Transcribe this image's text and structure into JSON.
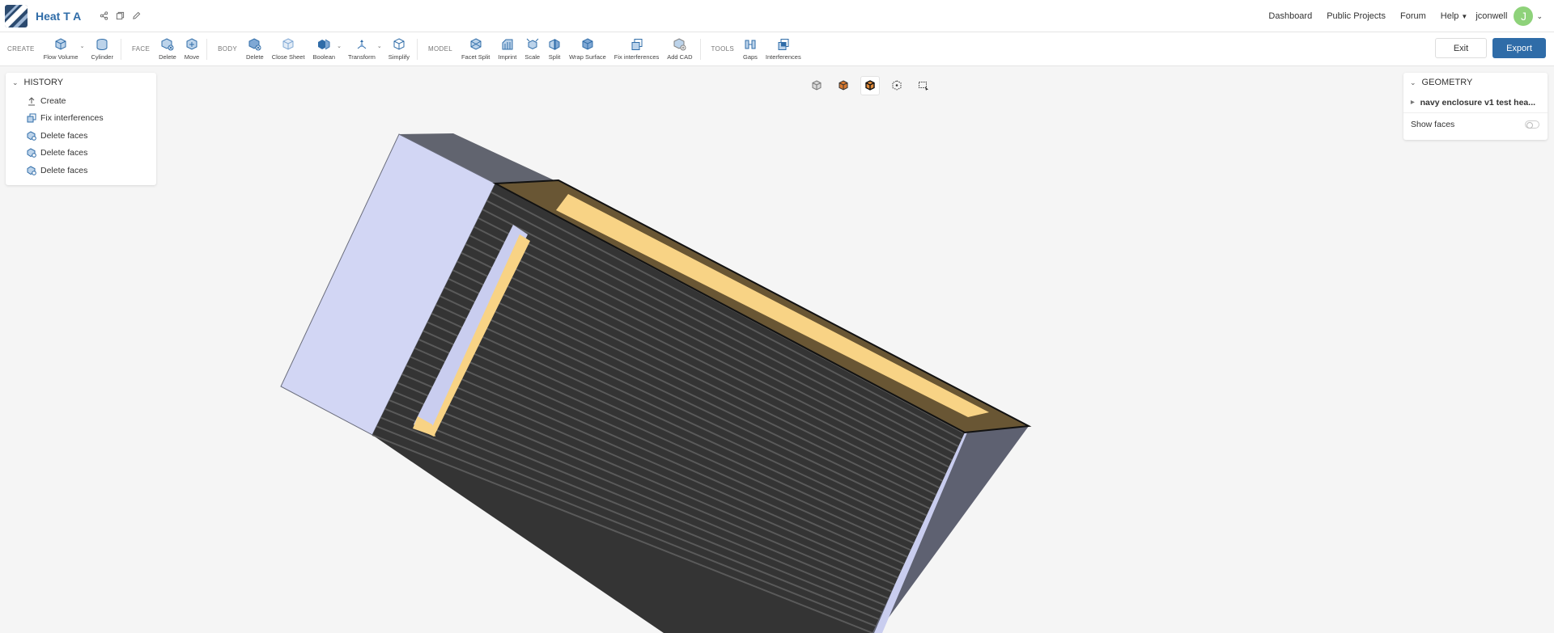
{
  "header": {
    "project_title": "Heat T A",
    "nav": {
      "dashboard": "Dashboard",
      "public_projects": "Public Projects",
      "forum": "Forum",
      "help": "Help",
      "user": "jconwell",
      "avatar_initial": "J"
    }
  },
  "toolbar": {
    "groups": {
      "create": "CREATE",
      "face": "FACE",
      "body": "BODY",
      "model": "MODEL",
      "tools": "TOOLS"
    },
    "create": {
      "flow_volume": "Flow Volume",
      "cylinder": "Cylinder"
    },
    "face": {
      "delete": "Delete",
      "move": "Move"
    },
    "body": {
      "delete": "Delete",
      "close_sheet": "Close Sheet",
      "boolean": "Boolean",
      "transform": "Transform",
      "simplify": "Simplify"
    },
    "model": {
      "facet_split": "Facet Split",
      "imprint": "Imprint",
      "scale": "Scale",
      "split": "Split",
      "wrap_surface": "Wrap Surface",
      "fix_interferences": "Fix interferences",
      "add_cad": "Add CAD"
    },
    "tools": {
      "gaps": "Gaps",
      "interferences": "Interferences"
    },
    "exit_label": "Exit",
    "export_label": "Export"
  },
  "history": {
    "title": "HISTORY",
    "items": [
      {
        "label": "Create",
        "icon": "upload-icon"
      },
      {
        "label": "Fix interferences",
        "icon": "fix-interferences-icon"
      },
      {
        "label": "Delete faces",
        "icon": "delete-faces-icon"
      },
      {
        "label": "Delete faces",
        "icon": "delete-faces-icon"
      },
      {
        "label": "Delete faces",
        "icon": "delete-faces-icon"
      }
    ]
  },
  "geometry": {
    "title": "GEOMETRY",
    "item": "navy enclosure v1 test hea...",
    "show_faces": "Show faces",
    "show_faces_on": false
  },
  "colors": {
    "accent": "#2f6ca8",
    "avatar": "#8ed27a",
    "model_face_light": "#d2d6f4",
    "model_face_dark": "#5e6171",
    "model_fins": "#333333",
    "model_highlight": "#f8d385"
  }
}
